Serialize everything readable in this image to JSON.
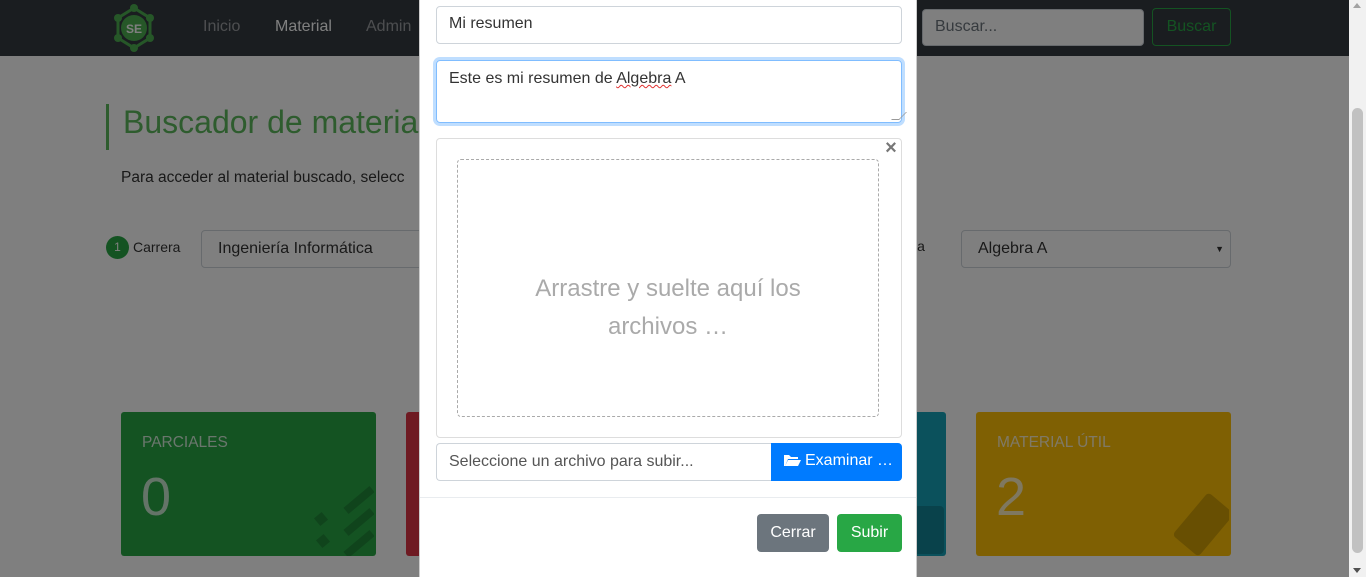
{
  "navbar": {
    "logo_text": "SE",
    "links": [
      "Inicio",
      "Material",
      "Admin"
    ],
    "active_link": "Material",
    "search_placeholder": "Buscar...",
    "search_button": "Buscar"
  },
  "page": {
    "title": "Buscador de materia",
    "description": "Para acceder al material buscado, selecc",
    "step_number": "1",
    "step_label": "Carrera",
    "carrera_value": "Ingeniería Informática",
    "materia_label": "ia",
    "materia_value": "Algebra A"
  },
  "cards": [
    {
      "label": "PARCIALES",
      "value": "0",
      "color": "#28a745"
    },
    {
      "label": "",
      "value": "",
      "color": "#dc3545"
    },
    {
      "label": "",
      "value": "",
      "color": "#17a2b8"
    },
    {
      "label": "MATERIAL ÚTIL",
      "value": "2",
      "color": "#ffc107"
    }
  ],
  "modal": {
    "title_value": "Mi resumen",
    "description_prefix": "Este es mi resumen de ",
    "description_word": "Algebra",
    "description_suffix": " A",
    "drop_text": "Arrastre y suelte aquí los archivos …",
    "close_icon": "×",
    "file_placeholder": "Seleccione un archivo para subir...",
    "browse_label": "Examinar …",
    "cancel_label": "Cerrar",
    "submit_label": "Subir"
  }
}
